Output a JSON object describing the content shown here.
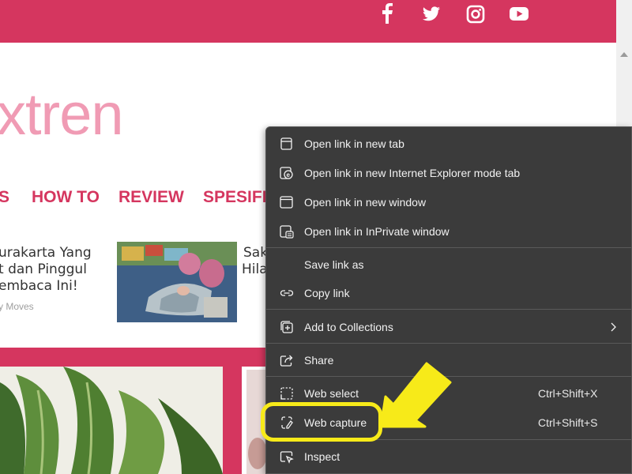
{
  "site": {
    "logo_text": "xtren",
    "nav": [
      "S",
      "HOW TO",
      "REVIEW",
      "SPESIFI"
    ],
    "article_left": {
      "lines": [
        "urakarta Yang",
        "t dan Pinggul",
        "embaca Ini!"
      ],
      "meta": "y Moves"
    },
    "article_right": {
      "lines": [
        "Sak",
        "Hila"
      ]
    },
    "social_icons": [
      "facebook-icon",
      "twitter-icon",
      "instagram-icon",
      "youtube-icon"
    ]
  },
  "context_menu": {
    "items": [
      {
        "icon": "new-tab-icon",
        "label": "Open link in new tab",
        "shortcut": ""
      },
      {
        "icon": "ie-mode-icon",
        "label": "Open link in new Internet Explorer mode tab",
        "shortcut": ""
      },
      {
        "icon": "new-window-icon",
        "label": "Open link in new window",
        "shortcut": ""
      },
      {
        "icon": "inprivate-icon",
        "label": "Open link in InPrivate window",
        "shortcut": ""
      },
      {
        "icon": "",
        "label": "Save link as",
        "shortcut": ""
      },
      {
        "icon": "link-icon",
        "label": "Copy link",
        "shortcut": ""
      },
      {
        "icon": "collections-icon",
        "label": "Add to Collections",
        "shortcut": ""
      },
      {
        "icon": "share-icon",
        "label": "Share",
        "shortcut": ""
      },
      {
        "icon": "web-select-icon",
        "label": "Web select",
        "shortcut": "Ctrl+Shift+X"
      },
      {
        "icon": "web-capture-icon",
        "label": "Web capture",
        "shortcut": "Ctrl+Shift+S"
      },
      {
        "icon": "inspect-icon",
        "label": "Inspect",
        "shortcut": ""
      }
    ]
  },
  "colors": {
    "brand_pink": "#d5365f",
    "logo_pink": "#f09bb4",
    "menu_bg": "#3b3b3b",
    "highlight_yellow": "#f7ea19"
  }
}
